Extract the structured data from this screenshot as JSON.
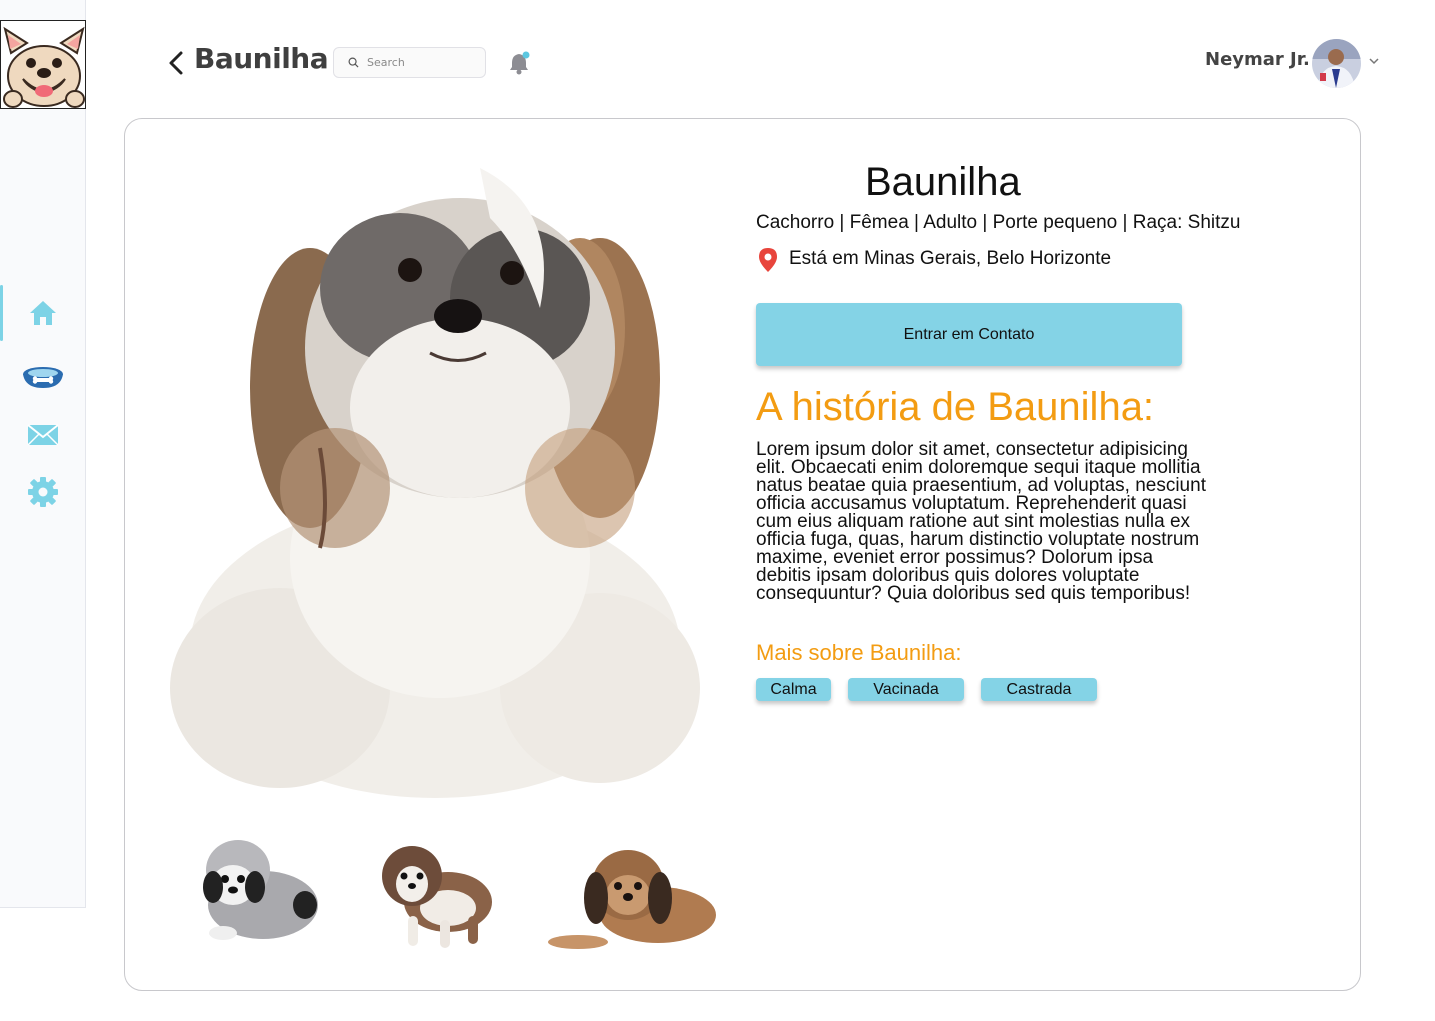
{
  "header": {
    "title": "Baunilha",
    "search_placeholder": "Search",
    "user_name": "Neymar Jr."
  },
  "sidebar": {
    "items": [
      {
        "icon": "home-icon",
        "active": true
      },
      {
        "icon": "pet-bowl-icon",
        "active": false
      },
      {
        "icon": "mail-icon",
        "active": false
      },
      {
        "icon": "gear-icon",
        "active": false
      }
    ]
  },
  "pet": {
    "name": "Baunilha",
    "info": "Cachorro | Fêmea | Adulto | Porte pequeno | Raça: Shitzu",
    "location": "Está em Minas Gerais, Belo Horizonte",
    "contact_label": "Entrar em Contato",
    "story_title": "A história de Baunilha:",
    "story_text": "Lorem ipsum dolor sit amet, consectetur adipisicing elit. Obcaecati enim doloremque sequi itaque mollitia natus beatae quia praesentium, ad voluptas, nesciunt officia accusamus voluptatum. Reprehenderit quasi cum eius aliquam ratione aut sint molestias nulla ex officia fuga, quas, harum distinctio voluptate nostrum maxime, eveniet error possimus? Dolorum ipsa debitis ipsam doloribus quis dolores voluptate consequuntur? Quia doloribus sed quis temporibus!",
    "more_title": "Mais sobre Baunilha:",
    "tags": [
      "Calma",
      "Vacinada",
      "Castrada"
    ]
  },
  "colors": {
    "accent": "#84d3e6",
    "orange": "#f39c12",
    "icon": "#7dd3e6"
  }
}
